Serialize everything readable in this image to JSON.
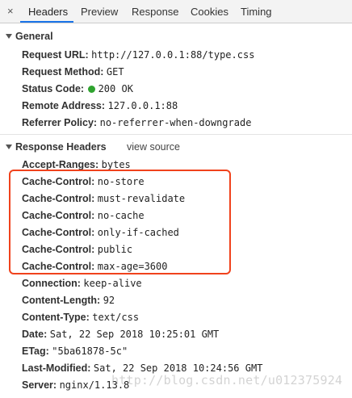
{
  "tabs": {
    "close_glyph": "×",
    "items": [
      "Headers",
      "Preview",
      "Response",
      "Cookies",
      "Timing"
    ],
    "active": "Headers"
  },
  "general": {
    "title": "General",
    "rows": [
      {
        "key": "Request URL:",
        "value": "http://127.0.0.1:88/type.css"
      },
      {
        "key": "Request Method:",
        "value": "GET"
      },
      {
        "key": "Status Code:",
        "value": "200 OK"
      },
      {
        "key": "Remote Address:",
        "value": "127.0.0.1:88"
      },
      {
        "key": "Referrer Policy:",
        "value": "no-referrer-when-downgrade"
      }
    ]
  },
  "response_headers": {
    "title": "Response Headers",
    "view_source_label": "view source",
    "rows": [
      {
        "key": "Accept-Ranges:",
        "value": "bytes"
      },
      {
        "key": "Cache-Control:",
        "value": "no-store"
      },
      {
        "key": "Cache-Control:",
        "value": "must-revalidate"
      },
      {
        "key": "Cache-Control:",
        "value": "no-cache"
      },
      {
        "key": "Cache-Control:",
        "value": "only-if-cached"
      },
      {
        "key": "Cache-Control:",
        "value": "public"
      },
      {
        "key": "Cache-Control:",
        "value": "max-age=3600"
      },
      {
        "key": "Connection:",
        "value": "keep-alive"
      },
      {
        "key": "Content-Length:",
        "value": "92"
      },
      {
        "key": "Content-Type:",
        "value": "text/css"
      },
      {
        "key": "Date:",
        "value": "Sat, 22 Sep 2018 10:25:01 GMT"
      },
      {
        "key": "ETag:",
        "value": "\"5ba61878-5c\""
      },
      {
        "key": "Last-Modified:",
        "value": "Sat, 22 Sep 2018 10:24:56 GMT"
      },
      {
        "key": "Server:",
        "value": "nginx/1.13.8"
      }
    ]
  },
  "colors": {
    "status_ok": "#2fa32f",
    "highlight_box": "#f0421c",
    "active_tab_underline": "#1a73e8"
  },
  "watermark": "http://blog.csdn.net/u012375924"
}
